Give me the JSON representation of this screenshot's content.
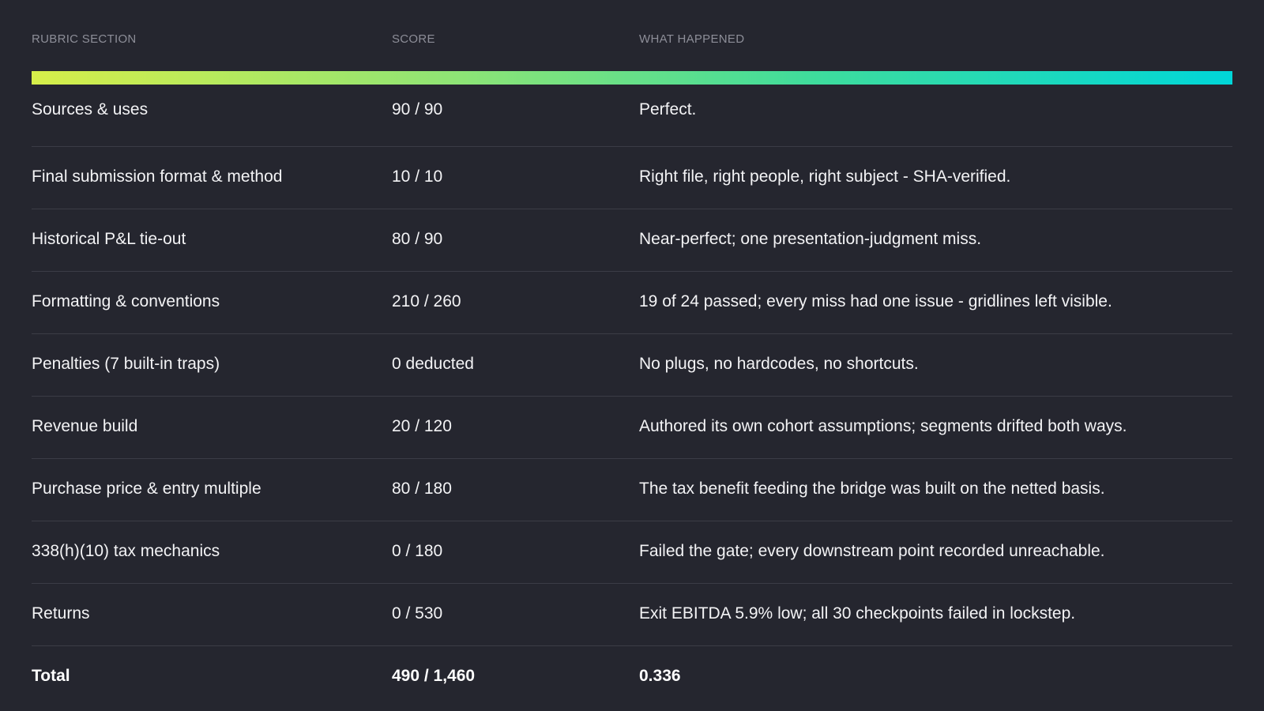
{
  "headers": {
    "section": "RUBRIC SECTION",
    "score": "SCORE",
    "what": "WHAT HAPPENED"
  },
  "rows": [
    {
      "section": "Sources & uses",
      "score": "90 / 90",
      "what": "Perfect."
    },
    {
      "section": "Final submission format & method",
      "score": "10 / 10",
      "what": "Right file, right people, right subject - SHA-verified."
    },
    {
      "section": "Historical P&L tie-out",
      "score": "80 / 90",
      "what": "Near-perfect; one presentation-judgment miss."
    },
    {
      "section": "Formatting & conventions",
      "score": "210 / 260",
      "what": "19 of 24 passed; every miss had one issue - gridlines left visible."
    },
    {
      "section": "Penalties (7 built-in traps)",
      "score": "0 deducted",
      "what": "No plugs, no hardcodes, no shortcuts."
    },
    {
      "section": "Revenue build",
      "score": "20 / 120",
      "what": "Authored its own cohort assumptions; segments drifted both ways."
    },
    {
      "section": "Purchase price & entry multiple",
      "score": "80 / 180",
      "what": "The tax benefit feeding the bridge was built on the netted basis."
    },
    {
      "section": "338(h)(10) tax mechanics",
      "score": "0 / 180",
      "what": "Failed the gate; every downstream point recorded unreachable."
    },
    {
      "section": "Returns",
      "score": "0 / 530",
      "what": "Exit EBITDA 5.9% low; all 30 checkpoints failed in lockstep."
    }
  ],
  "total": {
    "section": "Total",
    "score": "490 / 1,460",
    "what": "0.336"
  },
  "colors": {
    "background": "#25262f",
    "gradient_start": "#d6ee4a",
    "gradient_end": "#00d6d8",
    "header_text": "#8d8e98",
    "divider": "#3b3c46"
  }
}
